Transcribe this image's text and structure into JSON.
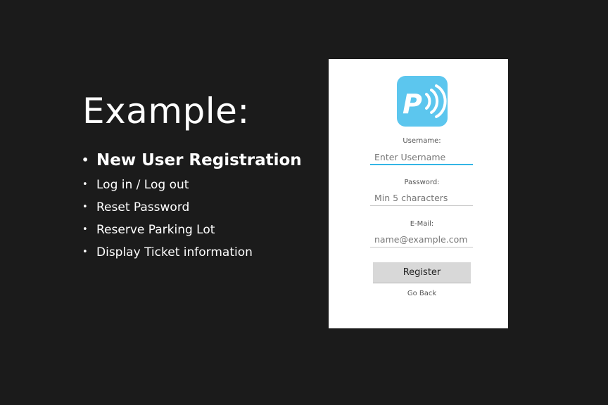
{
  "slide": {
    "title": "Example:",
    "bullets": [
      "New User Registration",
      "Log in / Log out",
      "Reset Password",
      "Reserve Parking Lot",
      "Display Ticket information"
    ]
  },
  "app": {
    "logo_letter": "P",
    "logo_icon": "parking-wireless-icon",
    "accent_color": "#5cc6ee",
    "focus_color": "#33b5e5",
    "username": {
      "label": "Username:",
      "placeholder": "Enter Username",
      "value": ""
    },
    "password": {
      "label": "Password:",
      "placeholder": "Min 5 characters",
      "value": ""
    },
    "email": {
      "label": "E-Mail:",
      "placeholder": "name@example.com",
      "value": ""
    },
    "register_label": "Register",
    "back_label": "Go Back"
  }
}
